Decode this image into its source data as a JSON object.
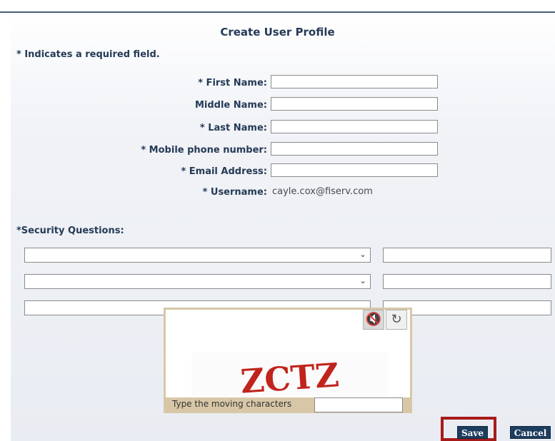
{
  "title": "Create User Profile",
  "required_note": "* Indicates a required field.",
  "fields": [
    {
      "label": "* First Name:",
      "value": ""
    },
    {
      "label": "Middle Name:",
      "value": ""
    },
    {
      "label": "* Last Name:",
      "value": ""
    },
    {
      "label": "* Mobile phone number:",
      "value": ""
    },
    {
      "label": "* Email Address:",
      "value": ""
    }
  ],
  "username": {
    "label": "* Username:",
    "value": "cayle.cox@fiserv.com"
  },
  "security": {
    "label": "*Security Questions:"
  },
  "captcha": {
    "text": "ZCTZ",
    "prompt": "Type the moving characters",
    "mute_icon": "speaker-muted-icon",
    "refresh_icon": "refresh-icon"
  },
  "buttons": {
    "save": "Save",
    "cancel": "Cancel"
  },
  "colors": {
    "label": "#253a56",
    "button": "#1d3d5e",
    "highlight": "#a71a1a",
    "captcha_text": "#c0241c"
  }
}
